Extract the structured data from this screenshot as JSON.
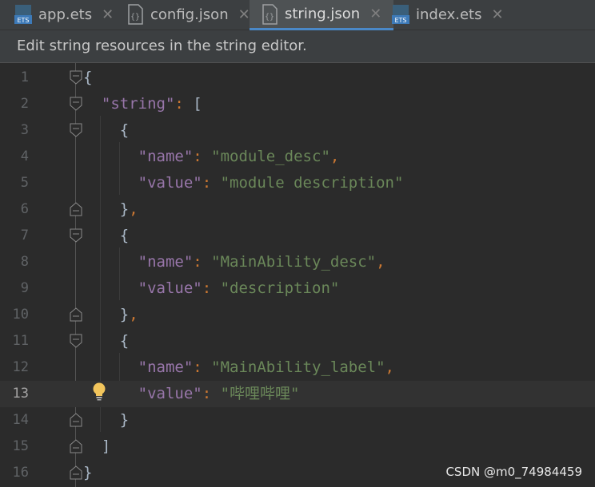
{
  "tabs": [
    {
      "label": "app.ets",
      "icon": "ets-file-icon",
      "active": false
    },
    {
      "label": "config.json",
      "icon": "json-file-icon",
      "active": false
    },
    {
      "label": "string.json",
      "icon": "json-file-icon",
      "active": true
    },
    {
      "label": "index.ets",
      "icon": "ets-file-icon",
      "active": false
    }
  ],
  "close_glyph": "✕",
  "notice": "Edit string resources in the string editor.",
  "lines": [
    {
      "n": "1"
    },
    {
      "n": "2"
    },
    {
      "n": "3"
    },
    {
      "n": "4"
    },
    {
      "n": "5"
    },
    {
      "n": "6"
    },
    {
      "n": "7"
    },
    {
      "n": "8"
    },
    {
      "n": "9"
    },
    {
      "n": "10"
    },
    {
      "n": "11"
    },
    {
      "n": "12"
    },
    {
      "n": "13"
    },
    {
      "n": "14"
    },
    {
      "n": "15"
    },
    {
      "n": "16"
    }
  ],
  "code": {
    "l1_brace": "{",
    "l2_key": "\"string\"",
    "l2_colon": ": ",
    "l2_bracket": "[",
    "l3": "{",
    "l4_key": "\"name\"",
    "l4_val": "\"module_desc\"",
    "l5_key": "\"value\"",
    "l5_val": "\"module description\"",
    "l6": "}",
    "l7": "{",
    "l8_key": "\"name\"",
    "l8_val": "\"MainAbility_desc\"",
    "l9_key": "\"value\"",
    "l9_val": "\"description\"",
    "l10": "}",
    "l11": "{",
    "l12_key": "\"name\"",
    "l12_val": "\"MainAbility_label\"",
    "l13_key": "\"value\"",
    "l13_val": "\"哔哩哔哩\"",
    "l14": "}",
    "l15": "]",
    "l16": "}",
    "colon": ": ",
    "comma": ","
  },
  "current_line": "13",
  "watermark": "CSDN @m0_74984459",
  "colors": {
    "key": "#9876aa",
    "string": "#6a8759",
    "punctuation": "#cc7832",
    "accent": "#4a88c7"
  }
}
